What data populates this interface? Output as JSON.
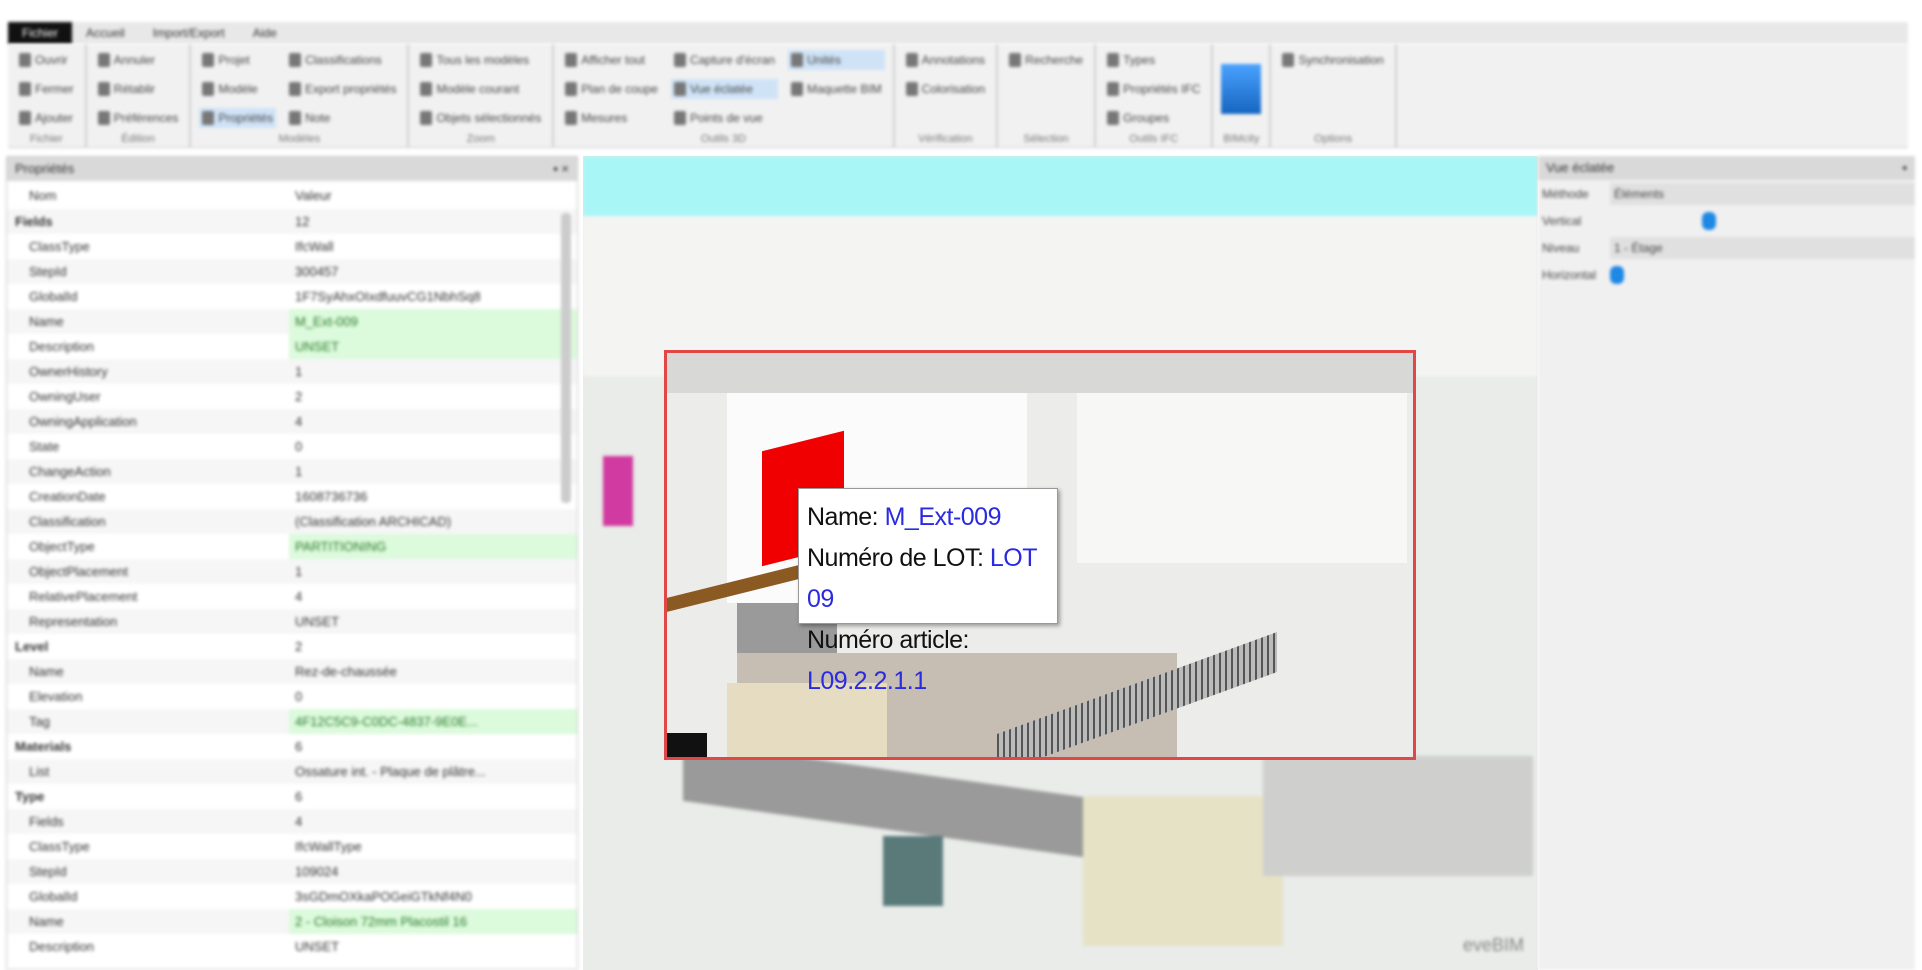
{
  "tabs": [
    "Fichier",
    "Accueil",
    "Import/Export",
    "Aide"
  ],
  "ribbon": {
    "groups": [
      {
        "label": "Fichier",
        "items": [
          "Ouvrir",
          "Fermer",
          "Ajouter"
        ]
      },
      {
        "label": "Édition",
        "items": [
          "Annuler",
          "Rétablir",
          "Préférences"
        ]
      },
      {
        "label": "Modèles",
        "items": [
          "Projet",
          "Modèle",
          "Propriétés",
          "Classifications",
          "Export propriétés",
          "Note"
        ]
      },
      {
        "label": "Zoom",
        "items": [
          "Tous les modèles",
          "Modèle courant",
          "Objets sélectionnés"
        ]
      },
      {
        "label": "Outils 3D",
        "items": [
          "Afficher tout",
          "Plan de coupe",
          "Mesures",
          "Capture d'écran",
          "Vue éclatée",
          "Points de vue",
          "Unités",
          "Maquette BIM"
        ]
      },
      {
        "label": "Vérification",
        "items": [
          "Annotations",
          "Colorisation"
        ]
      },
      {
        "label": "Sélection",
        "items": [
          "Recherche"
        ]
      },
      {
        "label": "Outils IFC",
        "items": [
          "Types",
          "Propriétés IFC",
          "Groupes"
        ]
      },
      {
        "label": "BIMcity",
        "items": []
      },
      {
        "label": "Options",
        "items": [
          "Synchronisation"
        ]
      }
    ]
  },
  "properties": {
    "title": "Propriétés",
    "col_name": "Nom",
    "col_value": "Valeur",
    "rows": [
      {
        "n": "Fields",
        "v": "12",
        "b": true
      },
      {
        "n": "ClassType",
        "v": "IfcWall"
      },
      {
        "n": "StepId",
        "v": "300457"
      },
      {
        "n": "GlobalId",
        "v": "1F7SyAhxOIxdfuuvCG1NbhSq8"
      },
      {
        "n": "Name",
        "v": "M_Ext-009",
        "g": true
      },
      {
        "n": "Description",
        "v": "UNSET",
        "g": true
      },
      {
        "n": "OwnerHistory",
        "v": "1"
      },
      {
        "n": "OwningUser",
        "v": "2"
      },
      {
        "n": "OwningApplication",
        "v": "4"
      },
      {
        "n": "State",
        "v": "0"
      },
      {
        "n": "ChangeAction",
        "v": "1"
      },
      {
        "n": "CreationDate",
        "v": "1608736736"
      },
      {
        "n": "Classification",
        "v": "(Classification ARCHICAD)"
      },
      {
        "n": "ObjectType",
        "v": "PARTITIONING",
        "g": true
      },
      {
        "n": "ObjectPlacement",
        "v": "1"
      },
      {
        "n": "RelativePlacement",
        "v": "4"
      },
      {
        "n": "Representation",
        "v": "UNSET"
      },
      {
        "n": "Level",
        "v": "2",
        "b": true
      },
      {
        "n": "Name",
        "v": "Rez-de-chaussée"
      },
      {
        "n": "Elevation",
        "v": "0"
      },
      {
        "n": "Tag",
        "v": "4F12C5C9-C0DC-4837-9E0E...",
        "g": true
      },
      {
        "n": "Materials",
        "v": "6",
        "b": true
      },
      {
        "n": "List",
        "v": "Ossature int. - Plaque de plâtre..."
      },
      {
        "n": "Type",
        "v": "6",
        "b": true
      },
      {
        "n": "Fields",
        "v": "4"
      },
      {
        "n": "ClassType",
        "v": "IfcWallType"
      },
      {
        "n": "StepId",
        "v": "109024"
      },
      {
        "n": "GlobalId",
        "v": "3sGDmOXkaPOGeiGTkNf4N0"
      },
      {
        "n": "Name",
        "v": "2 - Cloison 72mm Placostil 16",
        "g": true
      },
      {
        "n": "Description",
        "v": "UNSET"
      }
    ]
  },
  "tooltip": {
    "name_label": "Name:",
    "name_value": "M_Ext-009",
    "lot_label": "Numéro de LOT:",
    "lot_value": "LOT 09",
    "article_label": "Numéro article:",
    "article_value": "L09.2.2.1.1"
  },
  "right_panel": {
    "title": "Vue éclatée",
    "method_label": "Méthode",
    "method_value": "Éléments",
    "vertical_label": "Vertical",
    "vertical_value": 0.3,
    "niveau_label": "Niveau",
    "niveau_value": "1 - Étage",
    "horizontal_label": "Horizontal",
    "horizontal_value": 0.0
  },
  "watermark": "eveBIM"
}
